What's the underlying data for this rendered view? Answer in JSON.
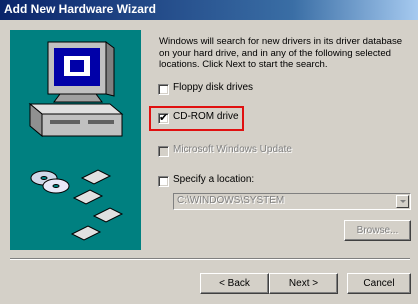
{
  "window": {
    "title": "Add New Hardware Wizard"
  },
  "intro_text": "Windows will search for new drivers in its driver database on your hard drive, and in any of the following selected locations. Click Next to start the search.",
  "options": [
    {
      "label": "Floppy disk drives",
      "checked": false,
      "enabled": true
    },
    {
      "label": "CD-ROM drive",
      "checked": true,
      "enabled": true
    },
    {
      "label": "Microsoft Windows Update",
      "checked": false,
      "enabled": false
    },
    {
      "label": "Specify a location:",
      "checked": false,
      "enabled": true
    }
  ],
  "location": {
    "value": "C:\\WINDOWS\\SYSTEM"
  },
  "buttons": {
    "browse": "Browse...",
    "back": "< Back",
    "next": "Next >",
    "cancel": "Cancel"
  },
  "colors": {
    "titlebar": "#0a246a",
    "art_background": "#008080",
    "highlight": "#e01010"
  }
}
